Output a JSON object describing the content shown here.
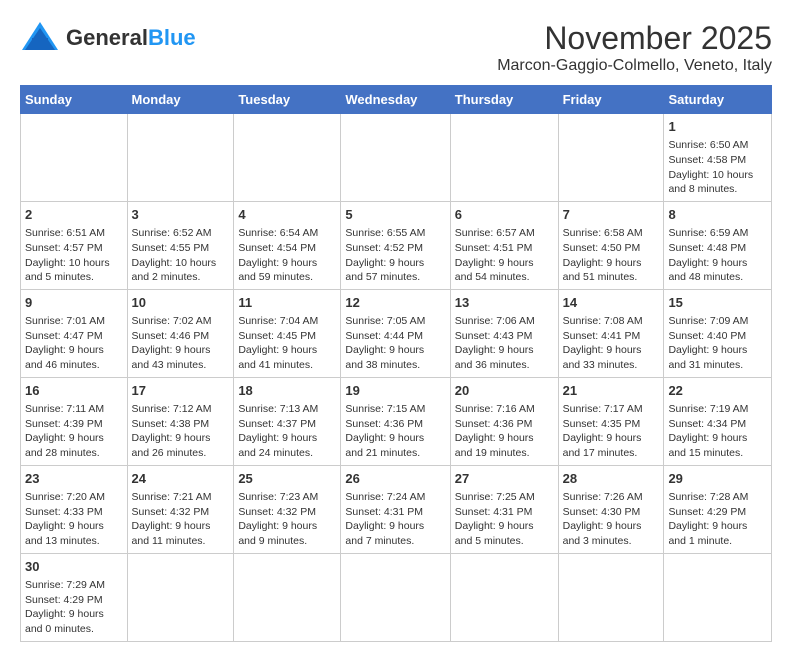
{
  "header": {
    "logo_general": "General",
    "logo_blue": "Blue",
    "month": "November 2025",
    "location": "Marcon-Gaggio-Colmello, Veneto, Italy"
  },
  "days_of_week": [
    "Sunday",
    "Monday",
    "Tuesday",
    "Wednesday",
    "Thursday",
    "Friday",
    "Saturday"
  ],
  "weeks": [
    [
      {
        "day": "",
        "info": ""
      },
      {
        "day": "",
        "info": ""
      },
      {
        "day": "",
        "info": ""
      },
      {
        "day": "",
        "info": ""
      },
      {
        "day": "",
        "info": ""
      },
      {
        "day": "",
        "info": ""
      },
      {
        "day": "1",
        "info": "Sunrise: 6:50 AM\nSunset: 4:58 PM\nDaylight: 10 hours\nand 8 minutes."
      }
    ],
    [
      {
        "day": "2",
        "info": "Sunrise: 6:51 AM\nSunset: 4:57 PM\nDaylight: 10 hours\nand 5 minutes."
      },
      {
        "day": "3",
        "info": "Sunrise: 6:52 AM\nSunset: 4:55 PM\nDaylight: 10 hours\nand 2 minutes."
      },
      {
        "day": "4",
        "info": "Sunrise: 6:54 AM\nSunset: 4:54 PM\nDaylight: 9 hours\nand 59 minutes."
      },
      {
        "day": "5",
        "info": "Sunrise: 6:55 AM\nSunset: 4:52 PM\nDaylight: 9 hours\nand 57 minutes."
      },
      {
        "day": "6",
        "info": "Sunrise: 6:57 AM\nSunset: 4:51 PM\nDaylight: 9 hours\nand 54 minutes."
      },
      {
        "day": "7",
        "info": "Sunrise: 6:58 AM\nSunset: 4:50 PM\nDaylight: 9 hours\nand 51 minutes."
      },
      {
        "day": "8",
        "info": "Sunrise: 6:59 AM\nSunset: 4:48 PM\nDaylight: 9 hours\nand 48 minutes."
      }
    ],
    [
      {
        "day": "9",
        "info": "Sunrise: 7:01 AM\nSunset: 4:47 PM\nDaylight: 9 hours\nand 46 minutes."
      },
      {
        "day": "10",
        "info": "Sunrise: 7:02 AM\nSunset: 4:46 PM\nDaylight: 9 hours\nand 43 minutes."
      },
      {
        "day": "11",
        "info": "Sunrise: 7:04 AM\nSunset: 4:45 PM\nDaylight: 9 hours\nand 41 minutes."
      },
      {
        "day": "12",
        "info": "Sunrise: 7:05 AM\nSunset: 4:44 PM\nDaylight: 9 hours\nand 38 minutes."
      },
      {
        "day": "13",
        "info": "Sunrise: 7:06 AM\nSunset: 4:43 PM\nDaylight: 9 hours\nand 36 minutes."
      },
      {
        "day": "14",
        "info": "Sunrise: 7:08 AM\nSunset: 4:41 PM\nDaylight: 9 hours\nand 33 minutes."
      },
      {
        "day": "15",
        "info": "Sunrise: 7:09 AM\nSunset: 4:40 PM\nDaylight: 9 hours\nand 31 minutes."
      }
    ],
    [
      {
        "day": "16",
        "info": "Sunrise: 7:11 AM\nSunset: 4:39 PM\nDaylight: 9 hours\nand 28 minutes."
      },
      {
        "day": "17",
        "info": "Sunrise: 7:12 AM\nSunset: 4:38 PM\nDaylight: 9 hours\nand 26 minutes."
      },
      {
        "day": "18",
        "info": "Sunrise: 7:13 AM\nSunset: 4:37 PM\nDaylight: 9 hours\nand 24 minutes."
      },
      {
        "day": "19",
        "info": "Sunrise: 7:15 AM\nSunset: 4:36 PM\nDaylight: 9 hours\nand 21 minutes."
      },
      {
        "day": "20",
        "info": "Sunrise: 7:16 AM\nSunset: 4:36 PM\nDaylight: 9 hours\nand 19 minutes."
      },
      {
        "day": "21",
        "info": "Sunrise: 7:17 AM\nSunset: 4:35 PM\nDaylight: 9 hours\nand 17 minutes."
      },
      {
        "day": "22",
        "info": "Sunrise: 7:19 AM\nSunset: 4:34 PM\nDaylight: 9 hours\nand 15 minutes."
      }
    ],
    [
      {
        "day": "23",
        "info": "Sunrise: 7:20 AM\nSunset: 4:33 PM\nDaylight: 9 hours\nand 13 minutes."
      },
      {
        "day": "24",
        "info": "Sunrise: 7:21 AM\nSunset: 4:32 PM\nDaylight: 9 hours\nand 11 minutes."
      },
      {
        "day": "25",
        "info": "Sunrise: 7:23 AM\nSunset: 4:32 PM\nDaylight: 9 hours\nand 9 minutes."
      },
      {
        "day": "26",
        "info": "Sunrise: 7:24 AM\nSunset: 4:31 PM\nDaylight: 9 hours\nand 7 minutes."
      },
      {
        "day": "27",
        "info": "Sunrise: 7:25 AM\nSunset: 4:31 PM\nDaylight: 9 hours\nand 5 minutes."
      },
      {
        "day": "28",
        "info": "Sunrise: 7:26 AM\nSunset: 4:30 PM\nDaylight: 9 hours\nand 3 minutes."
      },
      {
        "day": "29",
        "info": "Sunrise: 7:28 AM\nSunset: 4:29 PM\nDaylight: 9 hours\nand 1 minute."
      }
    ],
    [
      {
        "day": "30",
        "info": "Sunrise: 7:29 AM\nSunset: 4:29 PM\nDaylight: 9 hours\nand 0 minutes."
      },
      {
        "day": "",
        "info": ""
      },
      {
        "day": "",
        "info": ""
      },
      {
        "day": "",
        "info": ""
      },
      {
        "day": "",
        "info": ""
      },
      {
        "day": "",
        "info": ""
      },
      {
        "day": "",
        "info": ""
      }
    ]
  ]
}
